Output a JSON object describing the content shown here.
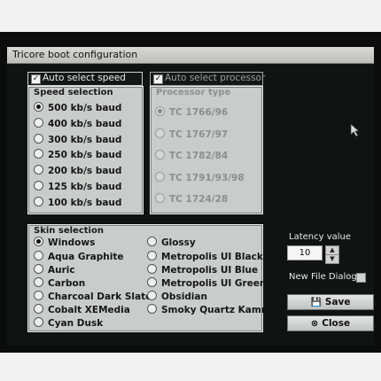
{
  "window": {
    "title": "Tricore boot configuration"
  },
  "auto_speed": {
    "label": "Auto select speed",
    "checked": true
  },
  "auto_processor": {
    "label": "Auto select processor",
    "checked": true
  },
  "speed": {
    "title": "Speed selection",
    "options": [
      "500 kb/s baud",
      "400 kb/s baud",
      "300 kb/s baud",
      "250 kb/s baud",
      "200 kb/s baud",
      "125 kb/s baud",
      "100 kb/s baud"
    ],
    "selected": "500 kb/s baud"
  },
  "processor": {
    "title": "Processor type",
    "options": [
      "TC 1766/96",
      "TC 1767/97",
      "TC 1782/84",
      "TC 1791/93/98",
      "TC 1724/28"
    ],
    "selected": "TC 1766/96"
  },
  "skin": {
    "title": "Skin selection",
    "col1": [
      "Windows",
      "Aqua Graphite",
      "Auric",
      "Carbon",
      "Charcoal Dark Slate",
      "Cobalt XEMedia",
      "Cyan Dusk"
    ],
    "col2": [
      "Glossy",
      "Metropolis UI Black",
      "Metropolis UI Blue",
      "Metropolis UI Green",
      "Obsidian",
      "Smoky Quartz Kamri"
    ],
    "selected": "Windows"
  },
  "latency": {
    "label": "Latency value",
    "value": "10"
  },
  "new_file_dialog": {
    "label": "New File Dialog",
    "checked": false
  },
  "buttons": {
    "save": "Save",
    "close": "Close"
  },
  "icons": {
    "save": "floppy-disk-icon",
    "close": "close-icon",
    "cursor": "mouse-pointer-icon"
  }
}
